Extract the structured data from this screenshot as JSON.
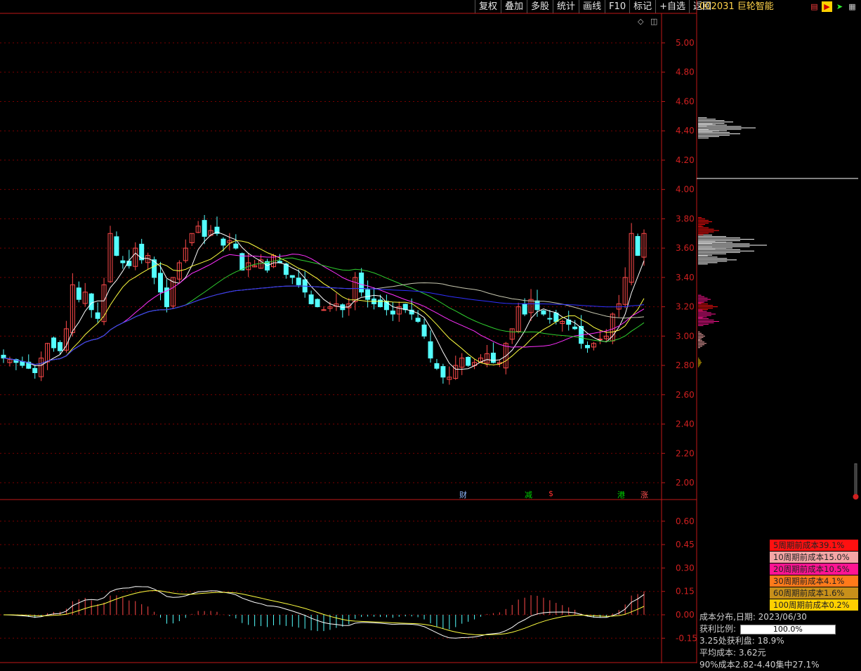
{
  "toolbar": {
    "items": [
      "复权",
      "叠加",
      "多股",
      "统计",
      "画线",
      "F10",
      "标记",
      "+自选",
      "返回"
    ]
  },
  "stock": {
    "code": "002031",
    "name": "巨轮智能"
  },
  "price_axis": {
    "labels": [
      "5.00",
      "4.80",
      "4.60",
      "4.40",
      "4.20",
      "4.00",
      "3.80",
      "3.60",
      "3.40",
      "3.20",
      "3.00",
      "2.80",
      "2.60",
      "2.40",
      "2.20",
      "2.00"
    ]
  },
  "macd_axis": {
    "labels": [
      "0.60",
      "0.45",
      "0.30",
      "0.15",
      "0.00",
      "-0.15"
    ]
  },
  "event_markers": [
    {
      "label": "财",
      "color": "#8fb8ff"
    },
    {
      "label": "减",
      "color": "#00d000"
    },
    {
      "label": "$",
      "color": "#ff3030"
    },
    {
      "label": "港",
      "color": "#00d000"
    },
    {
      "label": "涨",
      "color": "#ff5050"
    }
  ],
  "cost_legend": [
    {
      "label": "5周期前成本39.1%",
      "color": "#ff1010"
    },
    {
      "label": "10周期前成本15.0%",
      "color": "#f4a6a6"
    },
    {
      "label": "20周期前成本10.5%",
      "color": "#ff1493"
    },
    {
      "label": "30周期前成本4.1%",
      "color": "#ff7a1a"
    },
    {
      "label": "60周期前成本1.6%",
      "color": "#c8901a"
    },
    {
      "label": "100周期前成本0.2%",
      "color": "#ffd000"
    }
  ],
  "cost_info": {
    "date_line": "成本分布,日期: 2023/06/30",
    "profit_label": "获利比例:",
    "profit_value": "100.0%",
    "profit_at": "3.25处获利盘: 18.9%",
    "avg_cost": "平均成本: 3.62元",
    "concentration": "90%成本2.82-4.40集中27.1%"
  },
  "colors": {
    "up": "#ff4a4a",
    "down": "#54ffff",
    "grid": "#7a0000",
    "axis": "#c01818"
  },
  "chart_data": [
    {
      "type": "candlestick",
      "y_axis": {
        "min": 2.0,
        "max": 5.0,
        "ticks": [
          5.0,
          4.8,
          4.6,
          4.4,
          4.2,
          4.0,
          3.8,
          3.6,
          3.4,
          3.2,
          3.0,
          2.8,
          2.6,
          2.4,
          2.2,
          2.0
        ]
      },
      "closes": [
        2.85,
        2.84,
        2.82,
        2.8,
        2.78,
        2.75,
        2.85,
        2.95,
        2.92,
        2.9,
        3.05,
        3.35,
        3.25,
        3.3,
        3.18,
        3.12,
        3.35,
        3.7,
        3.55,
        3.5,
        3.48,
        3.6,
        3.52,
        3.55,
        3.4,
        3.3,
        3.2,
        3.4,
        3.5,
        3.6,
        3.7,
        3.75,
        3.68,
        3.72,
        3.7,
        3.62,
        3.65,
        3.6,
        3.45,
        3.5,
        3.48,
        3.52,
        3.45,
        3.55,
        3.5,
        3.42,
        3.4,
        3.35,
        3.3,
        3.22,
        3.2,
        3.18,
        3.2,
        3.22,
        3.18,
        3.22,
        3.4,
        3.3,
        3.25,
        3.22,
        3.2,
        3.18,
        3.15,
        3.2,
        3.18,
        3.15,
        3.1,
        3.0,
        2.85,
        2.78,
        2.72,
        2.72,
        2.8,
        2.85,
        2.8,
        2.82,
        2.85,
        2.88,
        2.82,
        2.82,
        2.95,
        3.05,
        3.2,
        3.15,
        3.25,
        3.18,
        3.15,
        3.12,
        3.1,
        3.1,
        3.08,
        3.05,
        2.95,
        2.92,
        2.95,
        2.98,
        3.0,
        3.15,
        3.22,
        3.4,
        3.7,
        3.55,
        3.7
      ],
      "ma_lines": [
        "white",
        "yellow",
        "magenta",
        "green",
        "gray",
        "blue"
      ]
    },
    {
      "type": "bar",
      "name": "MACD",
      "y_axis": {
        "min": -0.2,
        "max": 0.7,
        "ticks": [
          0.6,
          0.45,
          0.3,
          0.15,
          0.0,
          -0.15
        ]
      }
    }
  ]
}
